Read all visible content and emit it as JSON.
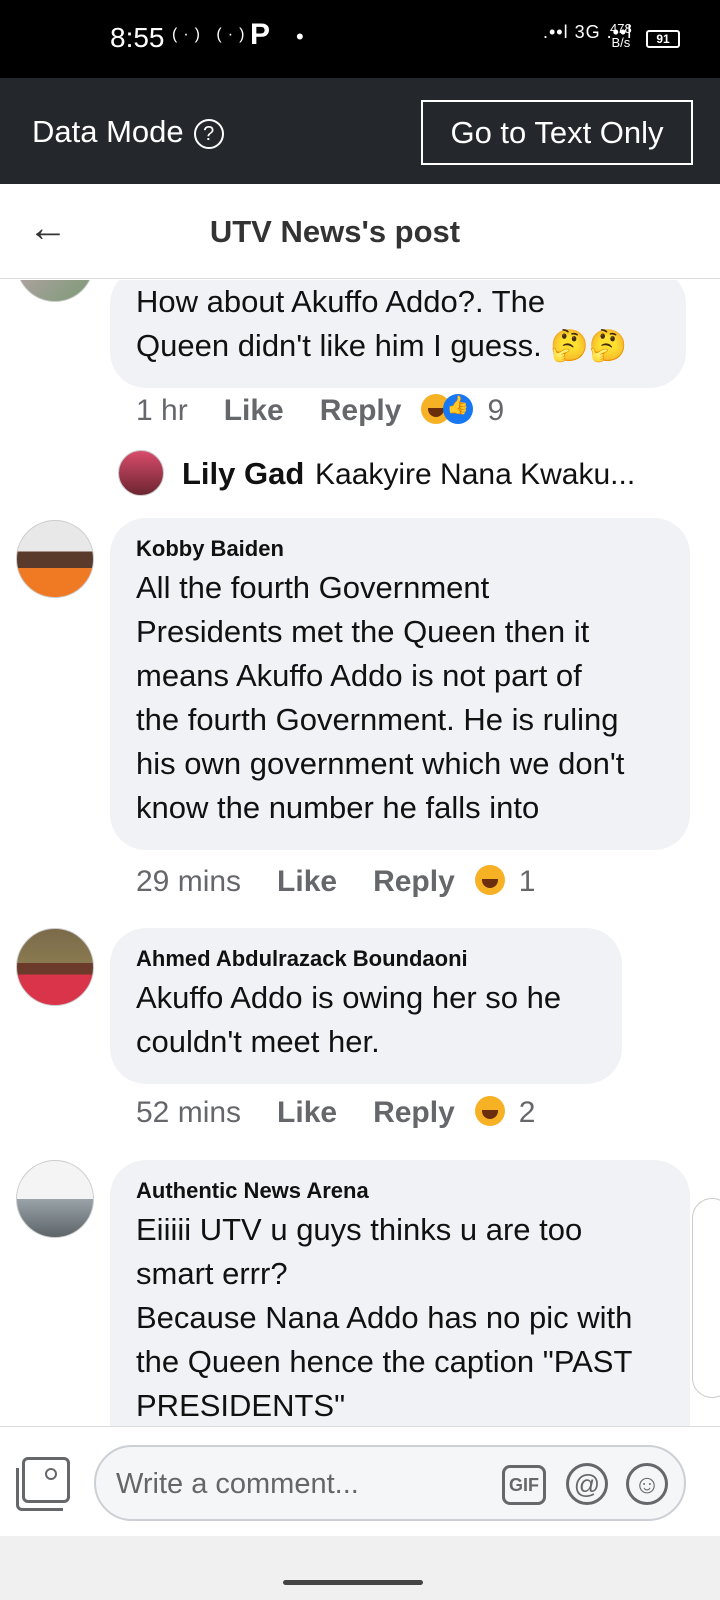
{
  "status_bar": {
    "time": "8:55",
    "left_icons": "(·) (·)",
    "p_icon": "P",
    "dot": "•",
    "signal": ".••l 3G .••l",
    "speed_value": "478",
    "speed_unit": "B/s",
    "battery": "91"
  },
  "data_mode": {
    "label": "Data Mode",
    "info_icon": "?",
    "text_only_button": "Go to Text Only"
  },
  "header": {
    "back_icon": "←",
    "title": "UTV News's post"
  },
  "comments": [
    {
      "author": "",
      "text_lines": [
        "How about Akuffo Addo?. The",
        "Queen didn't like him I guess. 🤔🤔"
      ],
      "time": "1 hr",
      "like": "Like",
      "reply": "Reply",
      "reaction_count": "9",
      "reply_preview": {
        "name": "Lily Gad",
        "text": "Kaakyire Nana Kwaku..."
      }
    },
    {
      "author": "Kobby Baiden",
      "text_lines": [
        "All the fourth Government",
        "Presidents met the Queen then it",
        "means Akuffo Addo is not part of",
        "the fourth Government. He is ruling",
        "his own government which we don't",
        "know the number he falls into"
      ],
      "time": "29 mins",
      "like": "Like",
      "reply": "Reply",
      "reaction_count": "1"
    },
    {
      "author": "Ahmed Abdulrazack Boundaoni",
      "text_lines": [
        "Akuffo Addo is owing her so he",
        "couldn't meet her."
      ],
      "time": "52 mins",
      "like": "Like",
      "reply": "Reply",
      "reaction_count": "2"
    },
    {
      "author": "Authentic News Arena",
      "text_lines": [
        "Eiiiii UTV u guys thinks u are  too",
        "smart errr?",
        "Because Nana Addo has no pic with",
        "the Queen hence the caption \"PAST",
        "PRESIDENTS\""
      ]
    }
  ],
  "composer": {
    "placeholder": "Write a comment...",
    "gif_label": "GIF",
    "at_label": "@",
    "smile_label": "☺"
  },
  "colors": {
    "status_bg": "#000000",
    "data_mode_bg": "#24272b",
    "bubble_bg": "#f0f2f5",
    "meta_text": "#65676b",
    "haha": "#f7b125",
    "like_blue": "#1877f2"
  }
}
